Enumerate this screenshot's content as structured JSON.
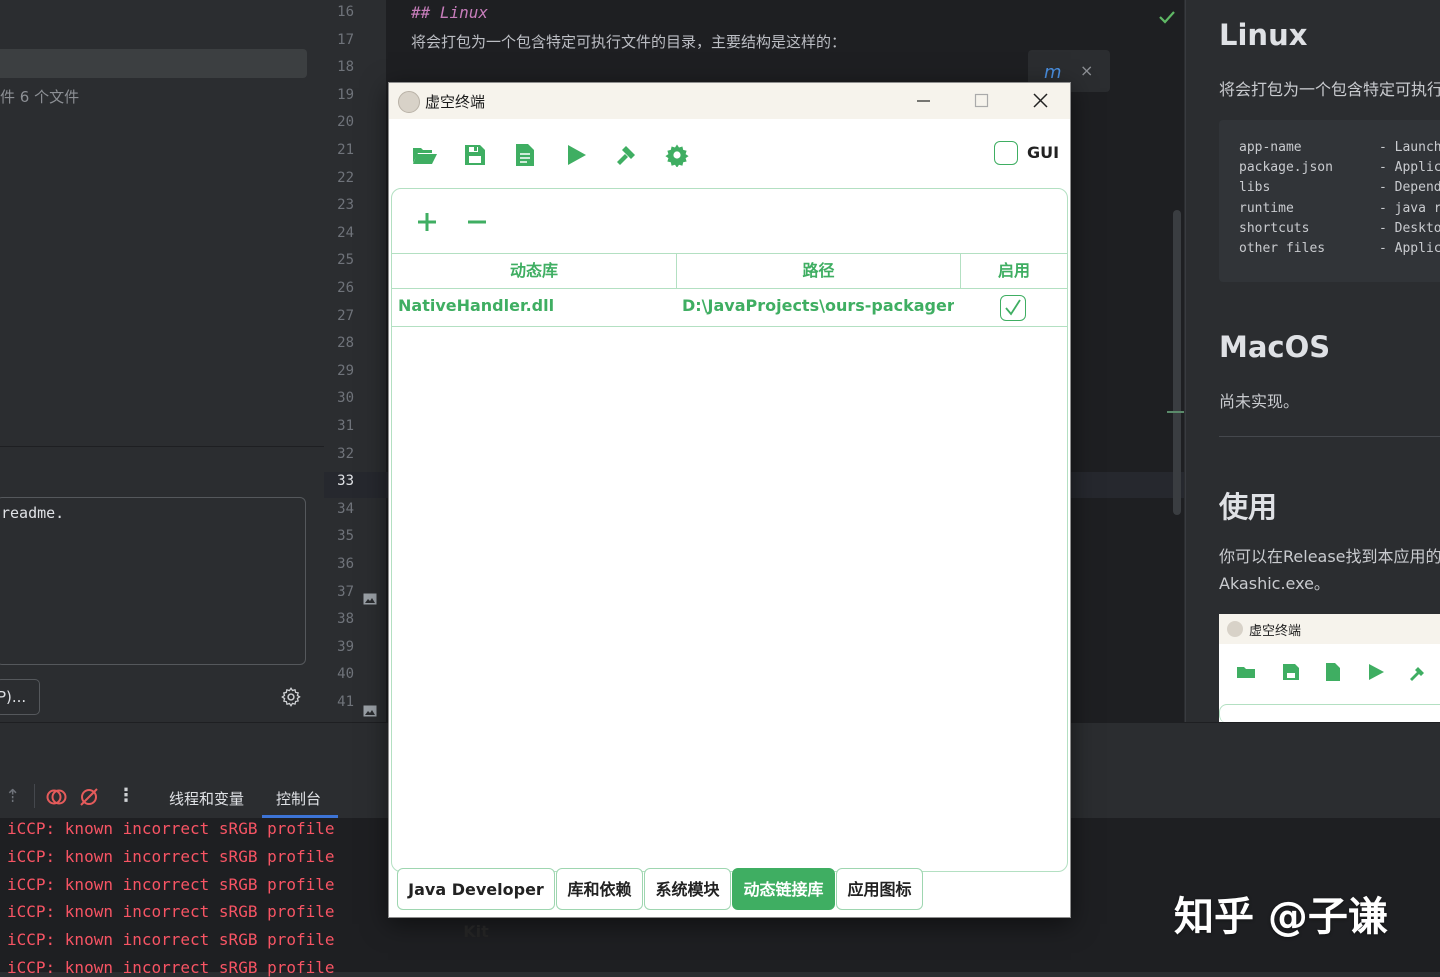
{
  "left_panel": {
    "file_count_text": "件 6 个文件",
    "commit_message": "readme.",
    "action_button_label": "P)..."
  },
  "editor": {
    "line_numbers": [
      "16",
      "17",
      "18",
      "19",
      "20",
      "21",
      "22",
      "23",
      "24",
      "25",
      "26",
      "27",
      "28",
      "29",
      "30",
      "31",
      "32",
      "33",
      "34",
      "35",
      "36",
      "37",
      "38",
      "39",
      "40",
      "41"
    ],
    "line16": "## Linux",
    "line17": "将会打包为一个包含特定可执行文件的目录，主要结构是这样的："
  },
  "preview": {
    "h_linux": "Linux",
    "p_linux": "将会打包为一个包含特定可执行",
    "code_rows": [
      [
        "app-name",
        "- Launch"
      ],
      [
        "package.json",
        "- Applic"
      ],
      [
        "libs",
        "- Depend"
      ],
      [
        "runtime",
        "- java r"
      ],
      [
        "shortcuts",
        "- Deskto"
      ],
      [
        "other files",
        "- Applic"
      ]
    ],
    "h_macos": "MacOS",
    "p_macos": "尚未实现。",
    "h_usage": "使用",
    "p_usage_1": "你可以在Release找到本应用的",
    "p_usage_2": "Akashic.exe。",
    "mini_title": "虚空终端"
  },
  "bottom": {
    "tab_threads": "线程和变量",
    "tab_console": "控制台",
    "console_lines": [
      "iCCP: known incorrect sRGB profile",
      "iCCP: known incorrect sRGB profile",
      "iCCP: known incorrect sRGB profile",
      "iCCP: known incorrect sRGB profile",
      "iCCP: known incorrect sRGB profile",
      "iCCP: known incorrect sRGB profile"
    ]
  },
  "app": {
    "title": "虚空终端",
    "gui_label": "GUI",
    "table": {
      "headers": [
        "动态库",
        "路径",
        "启用"
      ],
      "rows": [
        {
          "name": "NativeHandler.dll",
          "path": "D:\\JavaProjects\\ours-packager\\...",
          "enabled": true
        }
      ]
    },
    "tabs": [
      "Java Developer Kit",
      "库和依赖",
      "系统模块",
      "动态链接库",
      "应用图标"
    ],
    "active_tab": "动态链接库"
  },
  "watermark": "知乎 @子谦",
  "colors": {
    "accent": "#3fae62",
    "console_error": "#f75464"
  }
}
